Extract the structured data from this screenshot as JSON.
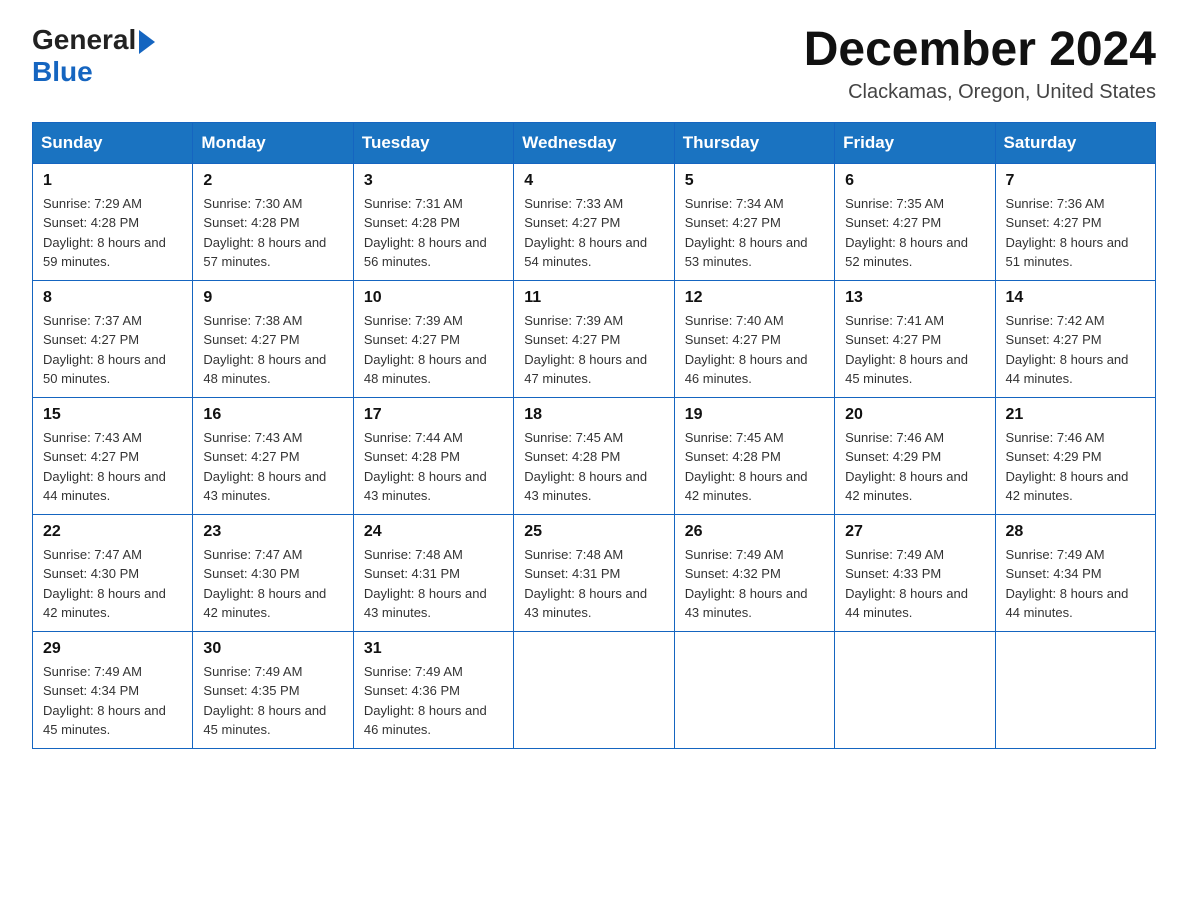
{
  "header": {
    "logo_general": "General",
    "logo_blue": "Blue",
    "month_title": "December 2024",
    "location": "Clackamas, Oregon, United States"
  },
  "weekdays": [
    "Sunday",
    "Monday",
    "Tuesday",
    "Wednesday",
    "Thursday",
    "Friday",
    "Saturday"
  ],
  "weeks": [
    [
      {
        "day": "1",
        "sunrise": "7:29 AM",
        "sunset": "4:28 PM",
        "daylight": "8 hours and 59 minutes."
      },
      {
        "day": "2",
        "sunrise": "7:30 AM",
        "sunset": "4:28 PM",
        "daylight": "8 hours and 57 minutes."
      },
      {
        "day": "3",
        "sunrise": "7:31 AM",
        "sunset": "4:28 PM",
        "daylight": "8 hours and 56 minutes."
      },
      {
        "day": "4",
        "sunrise": "7:33 AM",
        "sunset": "4:27 PM",
        "daylight": "8 hours and 54 minutes."
      },
      {
        "day": "5",
        "sunrise": "7:34 AM",
        "sunset": "4:27 PM",
        "daylight": "8 hours and 53 minutes."
      },
      {
        "day": "6",
        "sunrise": "7:35 AM",
        "sunset": "4:27 PM",
        "daylight": "8 hours and 52 minutes."
      },
      {
        "day": "7",
        "sunrise": "7:36 AM",
        "sunset": "4:27 PM",
        "daylight": "8 hours and 51 minutes."
      }
    ],
    [
      {
        "day": "8",
        "sunrise": "7:37 AM",
        "sunset": "4:27 PM",
        "daylight": "8 hours and 50 minutes."
      },
      {
        "day": "9",
        "sunrise": "7:38 AM",
        "sunset": "4:27 PM",
        "daylight": "8 hours and 48 minutes."
      },
      {
        "day": "10",
        "sunrise": "7:39 AM",
        "sunset": "4:27 PM",
        "daylight": "8 hours and 48 minutes."
      },
      {
        "day": "11",
        "sunrise": "7:39 AM",
        "sunset": "4:27 PM",
        "daylight": "8 hours and 47 minutes."
      },
      {
        "day": "12",
        "sunrise": "7:40 AM",
        "sunset": "4:27 PM",
        "daylight": "8 hours and 46 minutes."
      },
      {
        "day": "13",
        "sunrise": "7:41 AM",
        "sunset": "4:27 PM",
        "daylight": "8 hours and 45 minutes."
      },
      {
        "day": "14",
        "sunrise": "7:42 AM",
        "sunset": "4:27 PM",
        "daylight": "8 hours and 44 minutes."
      }
    ],
    [
      {
        "day": "15",
        "sunrise": "7:43 AM",
        "sunset": "4:27 PM",
        "daylight": "8 hours and 44 minutes."
      },
      {
        "day": "16",
        "sunrise": "7:43 AM",
        "sunset": "4:27 PM",
        "daylight": "8 hours and 43 minutes."
      },
      {
        "day": "17",
        "sunrise": "7:44 AM",
        "sunset": "4:28 PM",
        "daylight": "8 hours and 43 minutes."
      },
      {
        "day": "18",
        "sunrise": "7:45 AM",
        "sunset": "4:28 PM",
        "daylight": "8 hours and 43 minutes."
      },
      {
        "day": "19",
        "sunrise": "7:45 AM",
        "sunset": "4:28 PM",
        "daylight": "8 hours and 42 minutes."
      },
      {
        "day": "20",
        "sunrise": "7:46 AM",
        "sunset": "4:29 PM",
        "daylight": "8 hours and 42 minutes."
      },
      {
        "day": "21",
        "sunrise": "7:46 AM",
        "sunset": "4:29 PM",
        "daylight": "8 hours and 42 minutes."
      }
    ],
    [
      {
        "day": "22",
        "sunrise": "7:47 AM",
        "sunset": "4:30 PM",
        "daylight": "8 hours and 42 minutes."
      },
      {
        "day": "23",
        "sunrise": "7:47 AM",
        "sunset": "4:30 PM",
        "daylight": "8 hours and 42 minutes."
      },
      {
        "day": "24",
        "sunrise": "7:48 AM",
        "sunset": "4:31 PM",
        "daylight": "8 hours and 43 minutes."
      },
      {
        "day": "25",
        "sunrise": "7:48 AM",
        "sunset": "4:31 PM",
        "daylight": "8 hours and 43 minutes."
      },
      {
        "day": "26",
        "sunrise": "7:49 AM",
        "sunset": "4:32 PM",
        "daylight": "8 hours and 43 minutes."
      },
      {
        "day": "27",
        "sunrise": "7:49 AM",
        "sunset": "4:33 PM",
        "daylight": "8 hours and 44 minutes."
      },
      {
        "day": "28",
        "sunrise": "7:49 AM",
        "sunset": "4:34 PM",
        "daylight": "8 hours and 44 minutes."
      }
    ],
    [
      {
        "day": "29",
        "sunrise": "7:49 AM",
        "sunset": "4:34 PM",
        "daylight": "8 hours and 45 minutes."
      },
      {
        "day": "30",
        "sunrise": "7:49 AM",
        "sunset": "4:35 PM",
        "daylight": "8 hours and 45 minutes."
      },
      {
        "day": "31",
        "sunrise": "7:49 AM",
        "sunset": "4:36 PM",
        "daylight": "8 hours and 46 minutes."
      },
      null,
      null,
      null,
      null
    ]
  ]
}
